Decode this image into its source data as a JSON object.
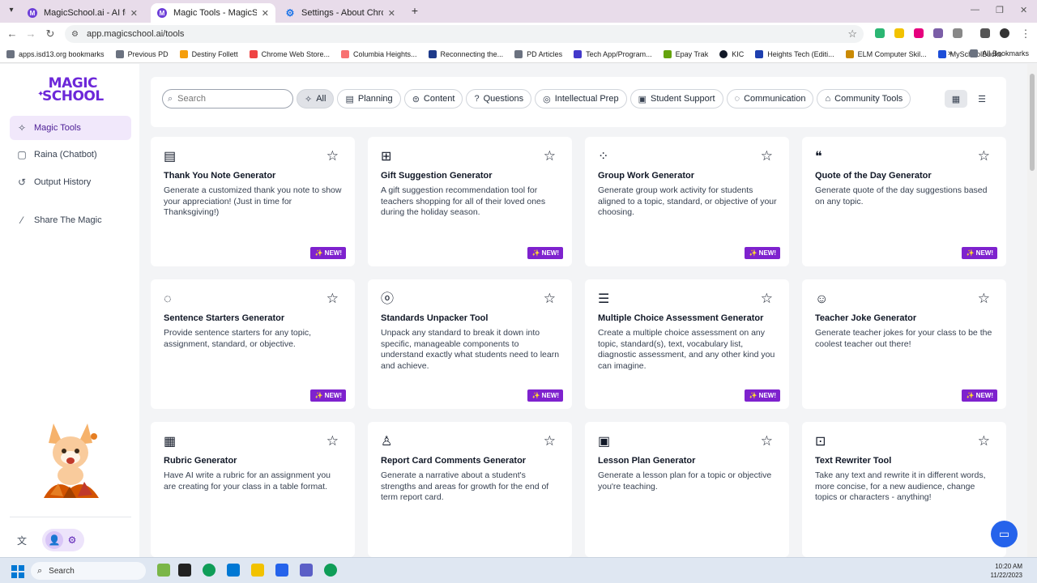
{
  "browser": {
    "tabs": [
      {
        "title": "MagicSchool.ai - AI for teache",
        "active": false
      },
      {
        "title": "Magic Tools - MagicSchool.ai",
        "active": true
      },
      {
        "title": "Settings - About Chrome",
        "active": false
      }
    ],
    "url": "app.magicschool.ai/tools",
    "bookmarks": [
      "apps.isd13.org bookmarks",
      "Previous PD",
      "Destiny Follett",
      "Chrome Web Store...",
      "Columbia Heights...",
      "Reconnecting the...",
      "PD Articles",
      "Tech App/Program...",
      "Epay Trak",
      "KIC",
      "Heights Tech (Editi...",
      "ELM Computer Skil...",
      "MySchoolBucks"
    ],
    "all_bookmarks": "All Bookmarks"
  },
  "sidebar": {
    "logo_line1": "MAGIC",
    "logo_line2": "SCHOOL",
    "items": [
      {
        "label": "Magic Tools",
        "icon": "sparkles-icon",
        "active": true
      },
      {
        "label": "Raina (Chatbot)",
        "icon": "chat-icon",
        "active": false
      },
      {
        "label": "Output History",
        "icon": "history-icon",
        "active": false
      },
      {
        "label": "Share The Magic",
        "icon": "wand-icon",
        "active": false
      }
    ]
  },
  "filters": {
    "search_placeholder": "Search",
    "chips": [
      {
        "label": "All",
        "icon": "sparkles-icon",
        "active": true
      },
      {
        "label": "Planning",
        "icon": "calendar-icon"
      },
      {
        "label": "Content",
        "icon": "content-icon"
      },
      {
        "label": "Questions",
        "icon": "question-icon"
      },
      {
        "label": "Intellectual Prep",
        "icon": "brain-icon"
      },
      {
        "label": "Student Support",
        "icon": "clipboard-icon"
      },
      {
        "label": "Communication",
        "icon": "messages-icon"
      },
      {
        "label": "Community Tools",
        "icon": "community-icon"
      }
    ]
  },
  "tools": [
    {
      "title": "Thank You Note Generator",
      "desc": "Generate a customized thank you note to show your appreciation! (Just in time for Thanksgiving!)",
      "badge": "✨ NEW!",
      "icon": "note-icon"
    },
    {
      "title": "Gift Suggestion Generator",
      "desc": "A gift suggestion recommendation tool for teachers shopping for all of their loved ones during the holiday season.",
      "badge": "✨ NEW!",
      "icon": "gift-icon"
    },
    {
      "title": "Group Work Generator",
      "desc": "Generate group work activity for students aligned to a topic, standard, or objective of your choosing.",
      "badge": "✨ NEW!",
      "icon": "group-icon"
    },
    {
      "title": "Quote of the Day Generator",
      "desc": "Generate quote of the day suggestions based on any topic.",
      "badge": "✨ NEW!",
      "icon": "quote-icon"
    },
    {
      "title": "Sentence Starters Generator",
      "desc": "Provide sentence starters for any topic, assignment, standard, or objective.",
      "badge": "✨ NEW!",
      "icon": "speech-bubble-icon"
    },
    {
      "title": "Standards Unpacker Tool",
      "desc": "Unpack any standard to break it down into specific, manageable components to understand exactly what students need to learn and achieve.",
      "badge": "✨ NEW!",
      "icon": "apple-icon"
    },
    {
      "title": "Multiple Choice Assessment Generator",
      "desc": "Create a multiple choice assessment on any topic, standard(s), text, vocabulary list, diagnostic assessment, and any other kind you can imagine.",
      "badge": "✨ NEW!",
      "icon": "list-icon"
    },
    {
      "title": "Teacher Joke Generator",
      "desc": "Generate teacher jokes for your class to be the coolest teacher out there!",
      "badge": "✨ NEW!",
      "icon": "laugh-icon"
    },
    {
      "title": "Rubric Generator",
      "desc": "Have AI write a rubric for an assignment you are creating for your class in a table format.",
      "badge": "",
      "icon": "grid-icon"
    },
    {
      "title": "Report Card Comments Generator",
      "desc": "Generate a narrative about a student's strengths and areas for growth for the end of term report card.",
      "badge": "",
      "icon": "user-star-icon"
    },
    {
      "title": "Lesson Plan Generator",
      "desc": "Generate a lesson plan for a topic or objective you're teaching.",
      "badge": "",
      "icon": "lesson-icon"
    },
    {
      "title": "Text Rewriter Tool",
      "desc": "Take any text and rewrite it in different words, more concise, for a new audience, change topics or characters - anything!",
      "badge": "",
      "icon": "rewrite-icon"
    }
  ],
  "taskbar": {
    "search": "Search",
    "time": "10:20 AM",
    "date": "11/22/2023"
  }
}
